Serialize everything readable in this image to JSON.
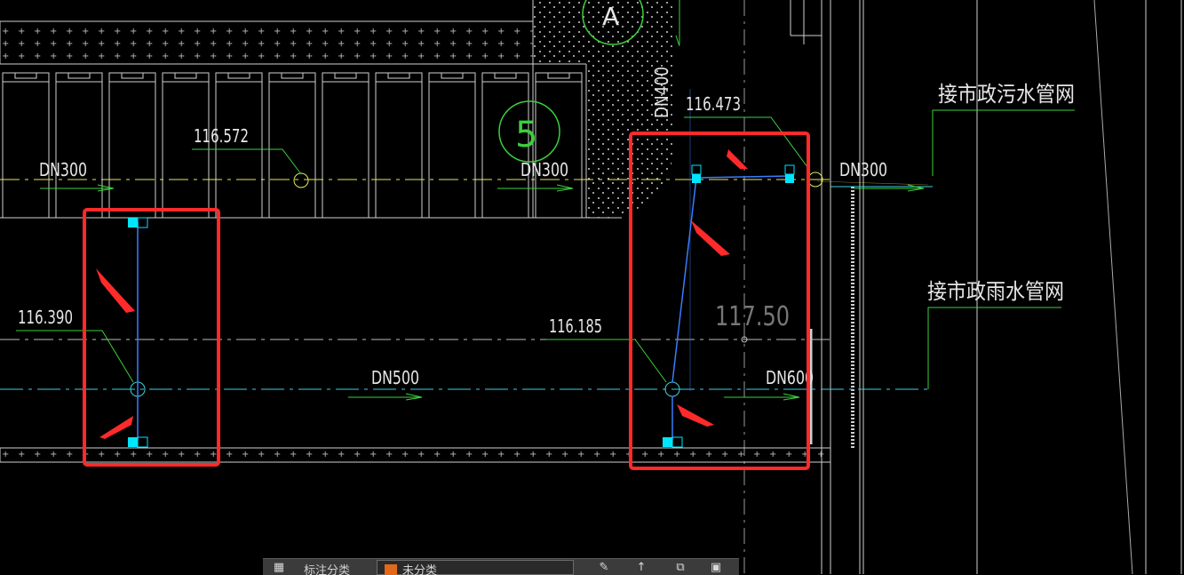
{
  "drawing": {
    "sheet_no": "5",
    "axis_label": "A",
    "callout_text": "A",
    "elevations": {
      "e_116_572": "116.572",
      "e_116_473": "116.473",
      "e_116_390": "116.390",
      "e_116_185": "116.185",
      "ground_117_50": "117.50"
    },
    "pipe_labels": {
      "sewer_left": "DN300",
      "sewer_mid": "DN300",
      "sewer_right": "DN300",
      "vertical": "DN400",
      "storm_mid": "DN500",
      "storm_right": "DN600"
    },
    "connections": {
      "sewer": "接市政污水管网",
      "storm": "接市政雨水管网"
    },
    "colors": {
      "sewer_line": "#e8e85a",
      "storm_line": "#3fd0e0",
      "branch_pipe": "#3a7cff",
      "leader": "#3ccf3c",
      "highlight": "#ff2a2a",
      "inlet": "#00e5ff"
    }
  },
  "toolbar": {
    "layer_label": "标注分类",
    "layer_value": "未分类",
    "icons": [
      "layers-icon",
      "edit-icon",
      "upload-icon",
      "copy-icon",
      "save-icon"
    ]
  }
}
